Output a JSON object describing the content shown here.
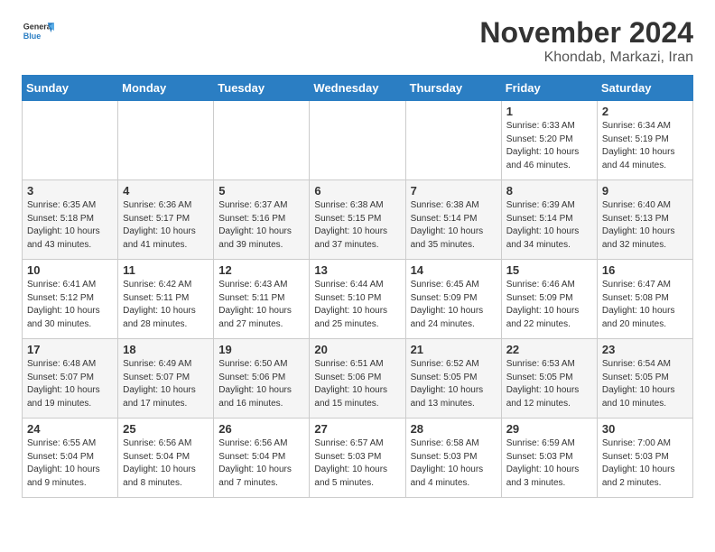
{
  "header": {
    "logo_general": "General",
    "logo_blue": "Blue",
    "month_title": "November 2024",
    "subtitle": "Khondab, Markazi, Iran"
  },
  "weekdays": [
    "Sunday",
    "Monday",
    "Tuesday",
    "Wednesday",
    "Thursday",
    "Friday",
    "Saturday"
  ],
  "weeks": [
    [
      {
        "day": "",
        "info": ""
      },
      {
        "day": "",
        "info": ""
      },
      {
        "day": "",
        "info": ""
      },
      {
        "day": "",
        "info": ""
      },
      {
        "day": "",
        "info": ""
      },
      {
        "day": "1",
        "info": "Sunrise: 6:33 AM\nSunset: 5:20 PM\nDaylight: 10 hours and 46 minutes."
      },
      {
        "day": "2",
        "info": "Sunrise: 6:34 AM\nSunset: 5:19 PM\nDaylight: 10 hours and 44 minutes."
      }
    ],
    [
      {
        "day": "3",
        "info": "Sunrise: 6:35 AM\nSunset: 5:18 PM\nDaylight: 10 hours and 43 minutes."
      },
      {
        "day": "4",
        "info": "Sunrise: 6:36 AM\nSunset: 5:17 PM\nDaylight: 10 hours and 41 minutes."
      },
      {
        "day": "5",
        "info": "Sunrise: 6:37 AM\nSunset: 5:16 PM\nDaylight: 10 hours and 39 minutes."
      },
      {
        "day": "6",
        "info": "Sunrise: 6:38 AM\nSunset: 5:15 PM\nDaylight: 10 hours and 37 minutes."
      },
      {
        "day": "7",
        "info": "Sunrise: 6:38 AM\nSunset: 5:14 PM\nDaylight: 10 hours and 35 minutes."
      },
      {
        "day": "8",
        "info": "Sunrise: 6:39 AM\nSunset: 5:14 PM\nDaylight: 10 hours and 34 minutes."
      },
      {
        "day": "9",
        "info": "Sunrise: 6:40 AM\nSunset: 5:13 PM\nDaylight: 10 hours and 32 minutes."
      }
    ],
    [
      {
        "day": "10",
        "info": "Sunrise: 6:41 AM\nSunset: 5:12 PM\nDaylight: 10 hours and 30 minutes."
      },
      {
        "day": "11",
        "info": "Sunrise: 6:42 AM\nSunset: 5:11 PM\nDaylight: 10 hours and 28 minutes."
      },
      {
        "day": "12",
        "info": "Sunrise: 6:43 AM\nSunset: 5:11 PM\nDaylight: 10 hours and 27 minutes."
      },
      {
        "day": "13",
        "info": "Sunrise: 6:44 AM\nSunset: 5:10 PM\nDaylight: 10 hours and 25 minutes."
      },
      {
        "day": "14",
        "info": "Sunrise: 6:45 AM\nSunset: 5:09 PM\nDaylight: 10 hours and 24 minutes."
      },
      {
        "day": "15",
        "info": "Sunrise: 6:46 AM\nSunset: 5:09 PM\nDaylight: 10 hours and 22 minutes."
      },
      {
        "day": "16",
        "info": "Sunrise: 6:47 AM\nSunset: 5:08 PM\nDaylight: 10 hours and 20 minutes."
      }
    ],
    [
      {
        "day": "17",
        "info": "Sunrise: 6:48 AM\nSunset: 5:07 PM\nDaylight: 10 hours and 19 minutes."
      },
      {
        "day": "18",
        "info": "Sunrise: 6:49 AM\nSunset: 5:07 PM\nDaylight: 10 hours and 17 minutes."
      },
      {
        "day": "19",
        "info": "Sunrise: 6:50 AM\nSunset: 5:06 PM\nDaylight: 10 hours and 16 minutes."
      },
      {
        "day": "20",
        "info": "Sunrise: 6:51 AM\nSunset: 5:06 PM\nDaylight: 10 hours and 15 minutes."
      },
      {
        "day": "21",
        "info": "Sunrise: 6:52 AM\nSunset: 5:05 PM\nDaylight: 10 hours and 13 minutes."
      },
      {
        "day": "22",
        "info": "Sunrise: 6:53 AM\nSunset: 5:05 PM\nDaylight: 10 hours and 12 minutes."
      },
      {
        "day": "23",
        "info": "Sunrise: 6:54 AM\nSunset: 5:05 PM\nDaylight: 10 hours and 10 minutes."
      }
    ],
    [
      {
        "day": "24",
        "info": "Sunrise: 6:55 AM\nSunset: 5:04 PM\nDaylight: 10 hours and 9 minutes."
      },
      {
        "day": "25",
        "info": "Sunrise: 6:56 AM\nSunset: 5:04 PM\nDaylight: 10 hours and 8 minutes."
      },
      {
        "day": "26",
        "info": "Sunrise: 6:56 AM\nSunset: 5:04 PM\nDaylight: 10 hours and 7 minutes."
      },
      {
        "day": "27",
        "info": "Sunrise: 6:57 AM\nSunset: 5:03 PM\nDaylight: 10 hours and 5 minutes."
      },
      {
        "day": "28",
        "info": "Sunrise: 6:58 AM\nSunset: 5:03 PM\nDaylight: 10 hours and 4 minutes."
      },
      {
        "day": "29",
        "info": "Sunrise: 6:59 AM\nSunset: 5:03 PM\nDaylight: 10 hours and 3 minutes."
      },
      {
        "day": "30",
        "info": "Sunrise: 7:00 AM\nSunset: 5:03 PM\nDaylight: 10 hours and 2 minutes."
      }
    ]
  ]
}
